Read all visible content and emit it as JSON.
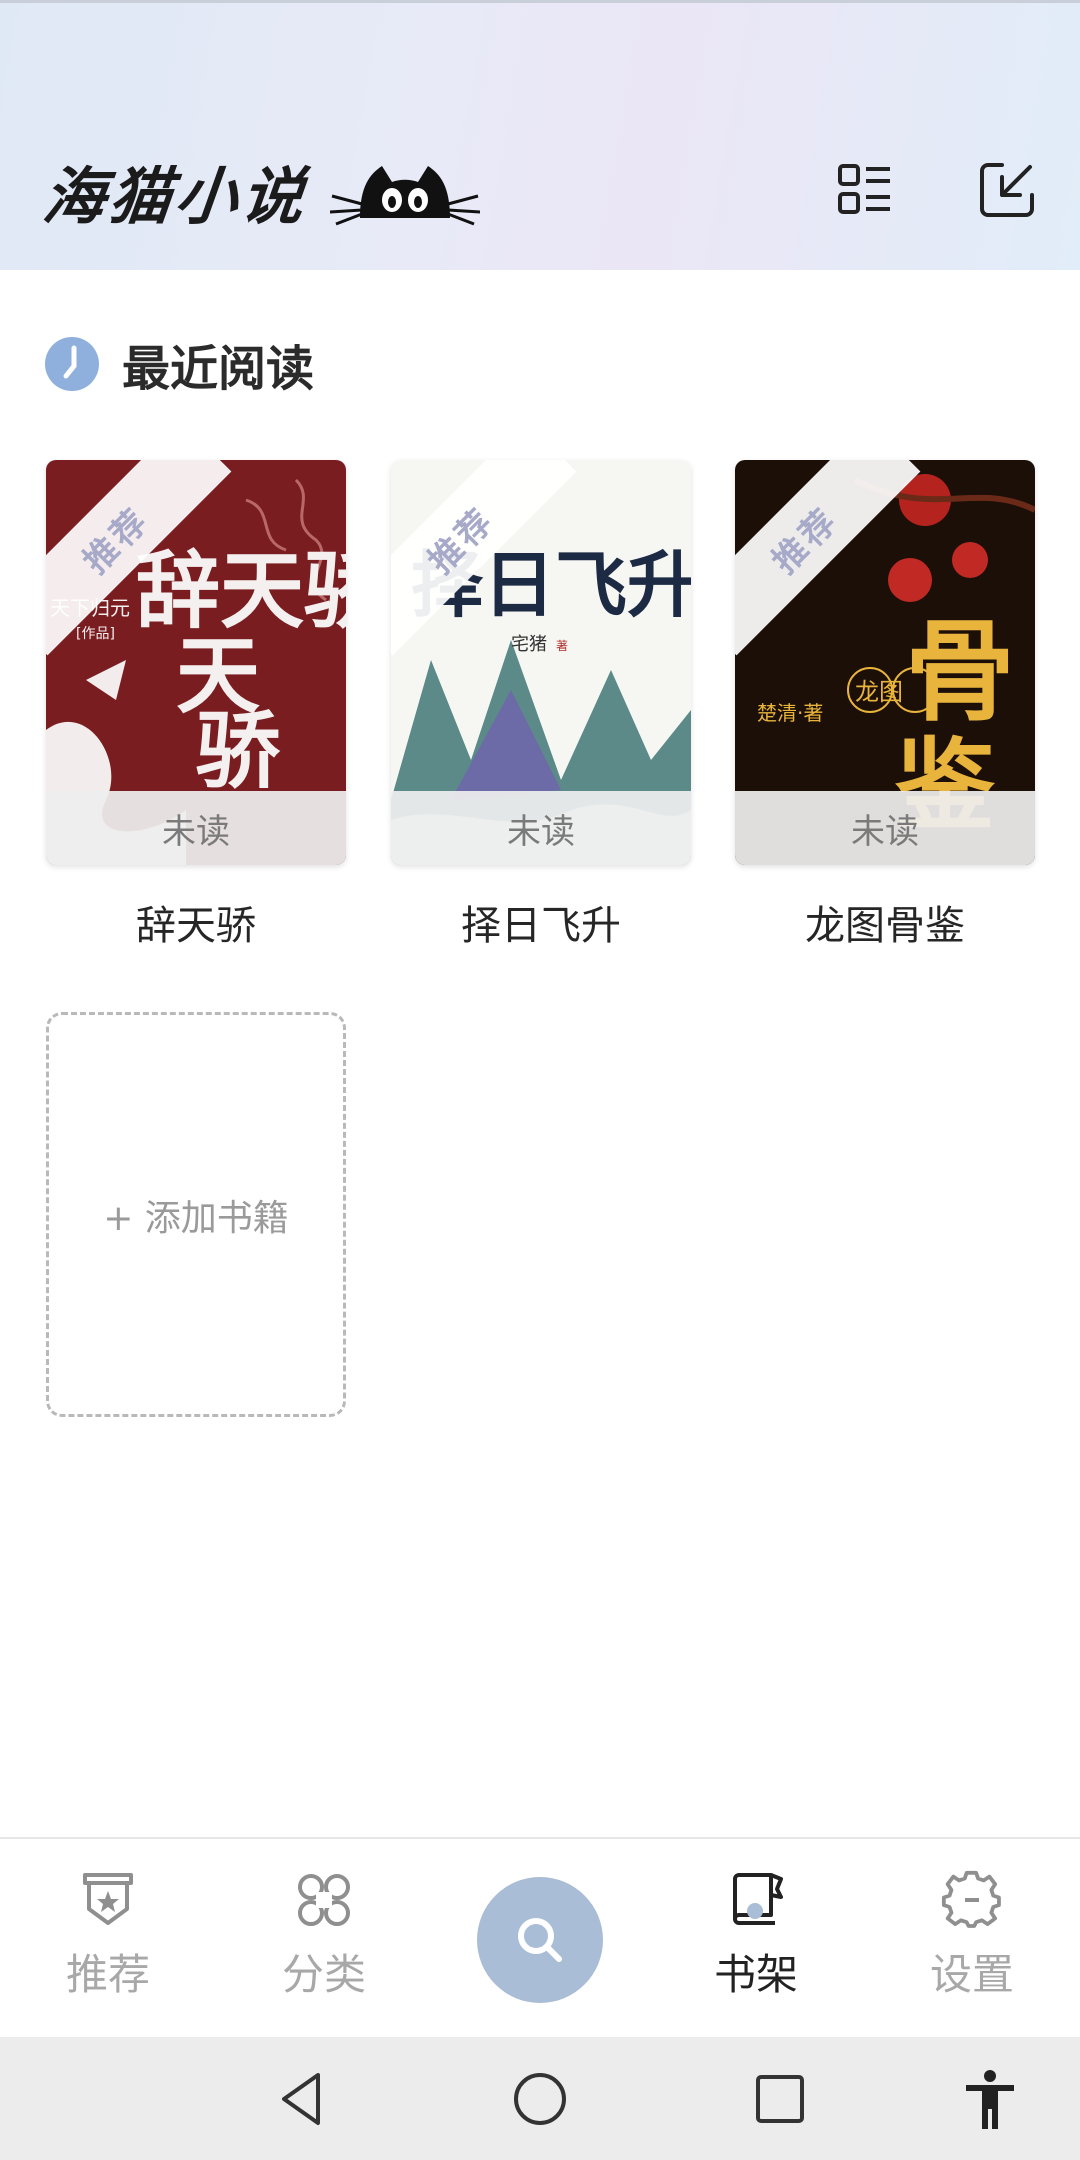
{
  "app": {
    "logo_text": "海猫小说"
  },
  "section": {
    "title": "最近阅读"
  },
  "books": [
    {
      "title": "辞天骄",
      "badge": "推荐",
      "status": "未读",
      "cover_text": "辞天骄",
      "cover_author": "天下归元",
      "cover_note": "[作品]"
    },
    {
      "title": "择日飞升",
      "badge": "推荐",
      "status": "未读",
      "cover_text": "择日飞升",
      "cover_author": "宅猪",
      "cover_note": "著"
    },
    {
      "title": "龙图骨鉴",
      "badge": "推荐",
      "status": "未读",
      "cover_text": "骨鉴",
      "cover_sub": "龙图",
      "cover_author": "楚清·著"
    }
  ],
  "add_book": {
    "label": "+ 添加书籍"
  },
  "bottom_nav": {
    "items": [
      {
        "label": "推荐",
        "icon": "recommend-badge-icon",
        "active": false
      },
      {
        "label": "分类",
        "icon": "category-grid-icon",
        "active": false
      },
      {
        "label": "",
        "icon": "search-icon",
        "active": false
      },
      {
        "label": "书架",
        "icon": "bookshelf-icon",
        "active": true
      },
      {
        "label": "设置",
        "icon": "settings-gear-icon",
        "active": false
      }
    ]
  },
  "colors": {
    "accent": "#a9bdd6",
    "text_primary": "#222222",
    "text_muted": "#a8a8a8"
  }
}
